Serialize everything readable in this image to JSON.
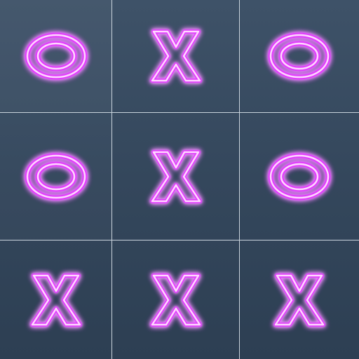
{
  "board": {
    "cells": [
      {
        "mark": "O"
      },
      {
        "mark": "X"
      },
      {
        "mark": "O"
      },
      {
        "mark": "O"
      },
      {
        "mark": "X"
      },
      {
        "mark": "O"
      },
      {
        "mark": "X"
      },
      {
        "mark": "X"
      },
      {
        "mark": "X"
      }
    ]
  },
  "colors": {
    "background": "#34475c",
    "grid_line": "#c9d3dc",
    "neon_glow": "#e040fb",
    "neon_core": "#ffd6ff"
  }
}
